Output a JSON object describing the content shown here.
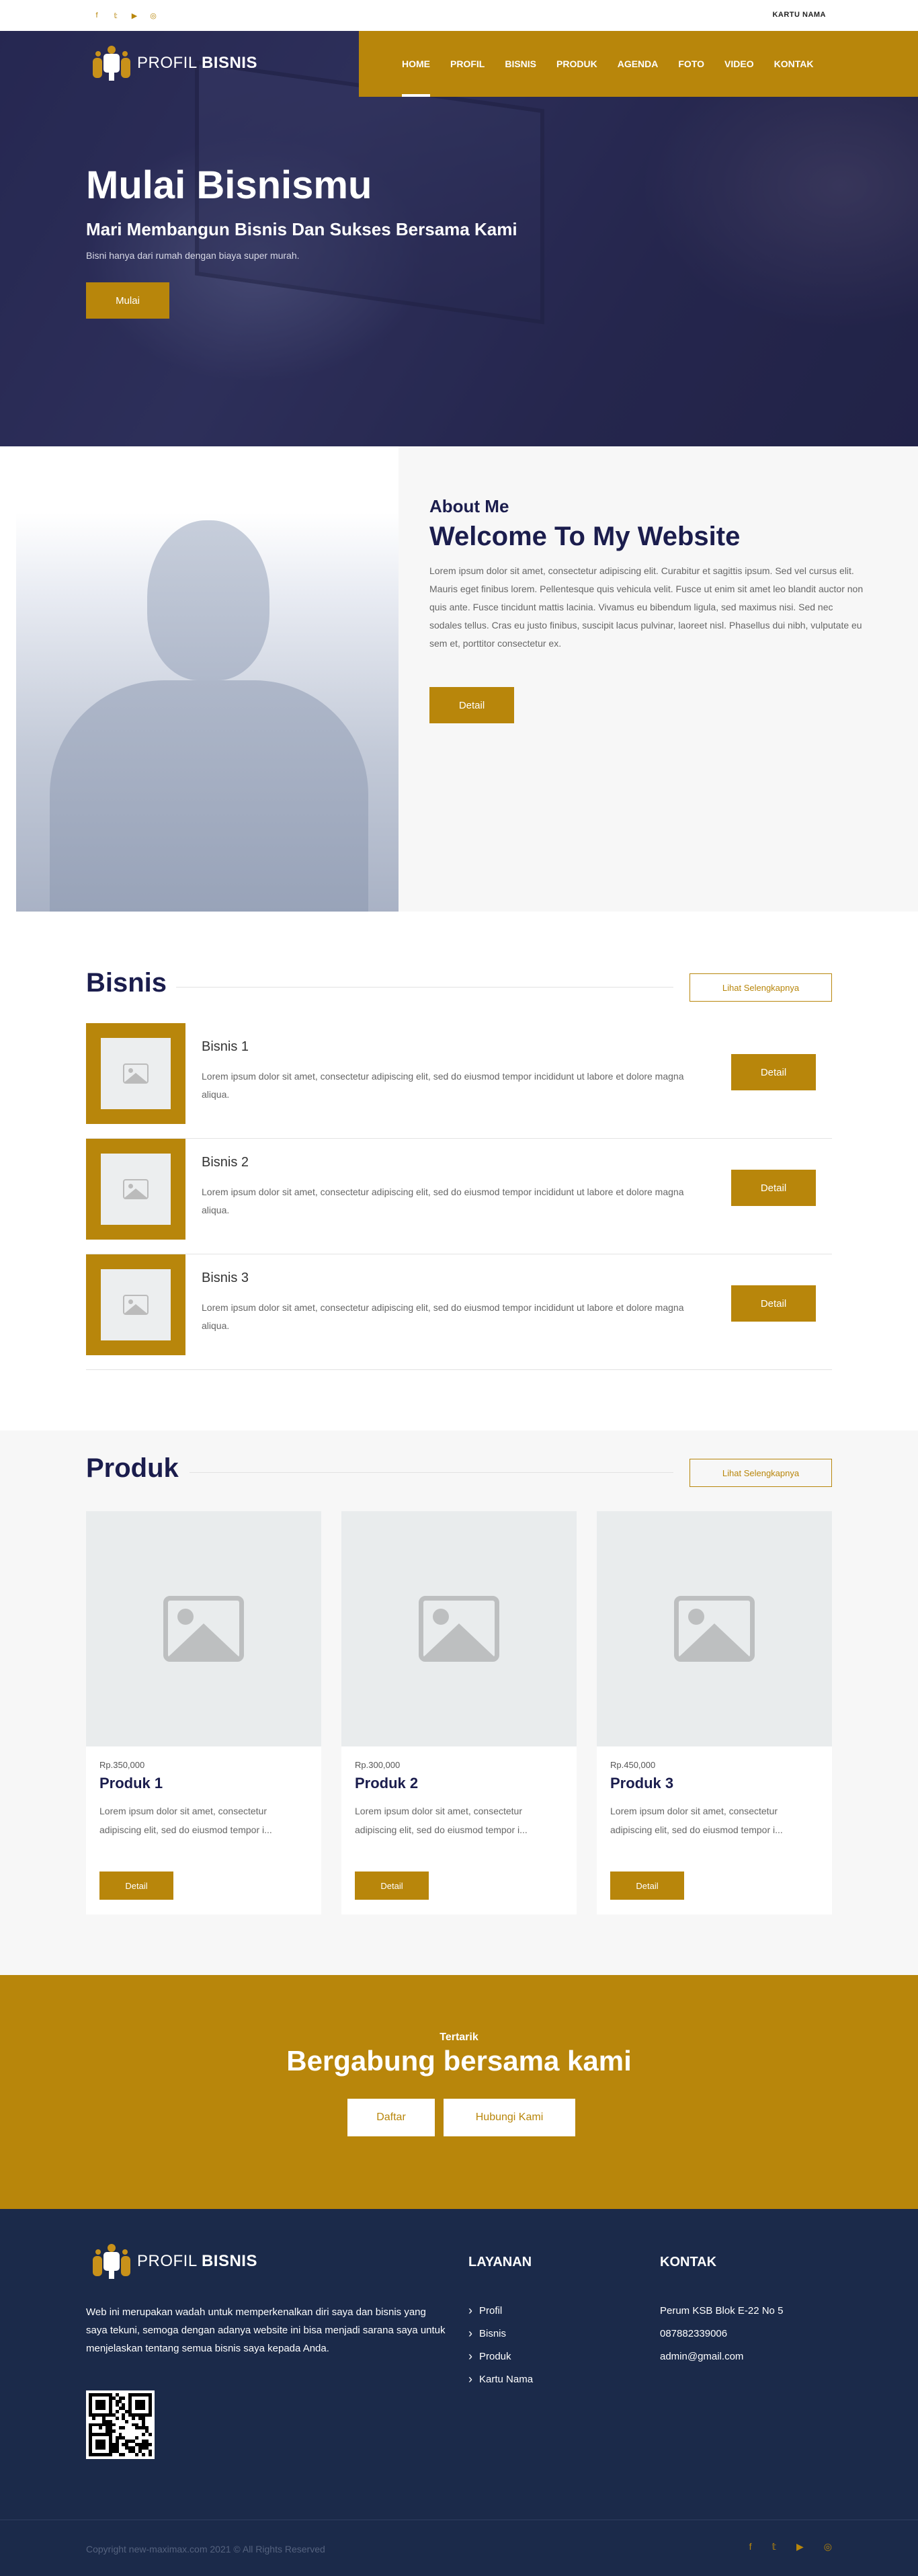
{
  "topbar": {
    "social": [
      "f",
      "𝕥",
      "▶",
      "◎"
    ],
    "social_names": [
      "facebook-icon",
      "twitter-icon",
      "youtube-icon",
      "instagram-icon"
    ],
    "kartu_nama": "KARTU NAMA"
  },
  "brand": {
    "profil": "PROFIL",
    "bisnis": "BISNIS"
  },
  "nav": [
    {
      "label": "HOME",
      "active": true
    },
    {
      "label": "PROFIL"
    },
    {
      "label": "BISNIS"
    },
    {
      "label": "PRODUK"
    },
    {
      "label": "AGENDA"
    },
    {
      "label": "FOTO"
    },
    {
      "label": "VIDEO"
    },
    {
      "label": "KONTAK"
    }
  ],
  "hero": {
    "title": "Mulai Bisnismu",
    "subtitle": "Mari Membangun Bisnis Dan Sukses Bersama Kami",
    "text": "Bisni hanya dari rumah dengan biaya super murah.",
    "button": "Mulai"
  },
  "about": {
    "kicker": "About Me",
    "title": "Welcome To My Website",
    "text": "Lorem ipsum dolor sit amet, consectetur adipiscing elit. Curabitur et sagittis ipsum. Sed vel cursus elit. Mauris eget finibus lorem. Pellentesque quis vehicula velit. Fusce ut enim sit amet leo blandit auctor non quis ante. Fusce tincidunt mattis lacinia. Vivamus eu bibendum ligula, sed maximus nisi. Sed nec sodales tellus. Cras eu justo finibus, suscipit lacus pulvinar, laoreet nisl. Phasellus dui nibh, vulputate eu sem et, porttitor consectetur ex.",
    "button": "Detail"
  },
  "bisnis": {
    "title": "Bisnis",
    "more": "Lihat Selengkapnya",
    "items": [
      {
        "name": "Bisnis 1",
        "desc": "Lorem ipsum dolor sit amet, consectetur adipiscing elit, sed do eiusmod tempor incididunt ut labore et dolore magna aliqua.",
        "button": "Detail"
      },
      {
        "name": "Bisnis 2",
        "desc": "Lorem ipsum dolor sit amet, consectetur adipiscing elit, sed do eiusmod tempor incididunt ut labore et dolore magna aliqua.",
        "button": "Detail"
      },
      {
        "name": "Bisnis 3",
        "desc": "Lorem ipsum dolor sit amet, consectetur adipiscing elit, sed do eiusmod tempor incididunt ut labore et dolore magna aliqua.",
        "button": "Detail"
      }
    ]
  },
  "produk": {
    "title": "Produk",
    "more": "Lihat Selengkapnya",
    "items": [
      {
        "price": "Rp.350,000",
        "name": "Produk 1",
        "desc": "Lorem ipsum dolor sit amet, consectetur adipiscing elit, sed do eiusmod tempor i...",
        "button": "Detail"
      },
      {
        "price": "Rp.300,000",
        "name": "Produk 2",
        "desc": "Lorem ipsum dolor sit amet, consectetur adipiscing elit, sed do eiusmod tempor i...",
        "button": "Detail"
      },
      {
        "price": "Rp.450,000",
        "name": "Produk 3",
        "desc": "Lorem ipsum dolor sit amet, consectetur adipiscing elit, sed do eiusmod tempor i...",
        "button": "Detail"
      }
    ]
  },
  "cta": {
    "small": "Tertarik",
    "big": "Bergabung bersama kami",
    "daftar": "Daftar",
    "hubungi": "Hubungi Kami"
  },
  "footer": {
    "about": "Web ini merupakan wadah untuk memperkenalkan diri saya dan bisnis yang saya tekuni, semoga dengan adanya website ini bisa menjadi sarana saya untuk menjelaskan tentang semua bisnis saya kepada Anda.",
    "layanan_title": "LAYANAN",
    "layanan": [
      "Profil",
      "Bisnis",
      "Produk",
      "Kartu Nama"
    ],
    "kontak_title": "KONTAK",
    "kontak": [
      "Perum KSB Blok E-22 No 5",
      "087882339006",
      "admin@gmail.com"
    ],
    "copyright": "Copyright new-maximax.com 2021 © All Rights Reserved",
    "social": [
      "f",
      "𝕥",
      "▶",
      "◎"
    ]
  },
  "colors": {
    "gold": "#b8860b",
    "navy": "#1b1d4d",
    "footer": "#1b2a4a"
  }
}
